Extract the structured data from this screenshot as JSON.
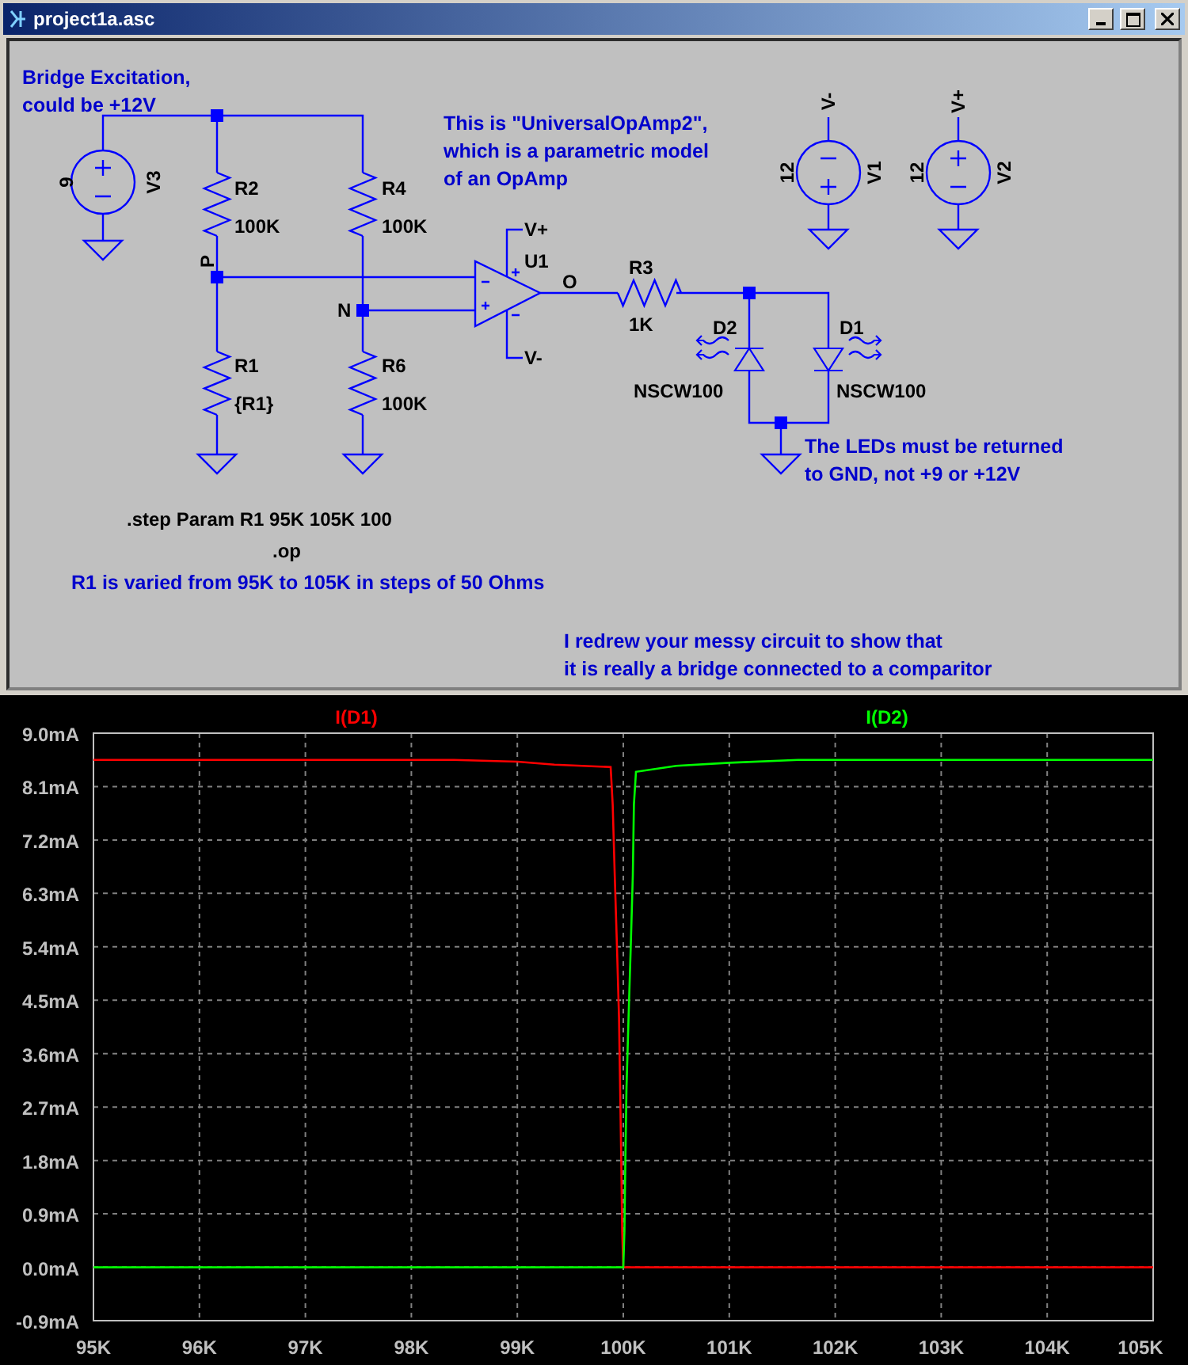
{
  "window": {
    "title": "project1a.asc"
  },
  "schematic": {
    "notes": [
      {
        "lines": [
          "Bridge Excitation,",
          "could be +12V"
        ]
      },
      {
        "lines": [
          "This is \"UniversalOpAmp2\",",
          "which is a parametric model",
          "of an OpAmp"
        ]
      },
      {
        "lines": [
          "The LEDs must be returned",
          "to GND, not +9 or +12V"
        ]
      },
      {
        "lines": [
          "R1 is varied from 95K to 105K in steps of 50 Ohms"
        ]
      },
      {
        "lines": [
          "I redrew your messy circuit to show that",
          "it is really a bridge connected to a comparitor"
        ]
      }
    ],
    "components": [
      {
        "kind": "voltage_source",
        "ref": "V3",
        "value": "9"
      },
      {
        "kind": "resistor",
        "ref": "R2",
        "value": "100K"
      },
      {
        "kind": "resistor",
        "ref": "R4",
        "value": "100K"
      },
      {
        "kind": "opamp",
        "ref": "U1"
      },
      {
        "kind": "resistor",
        "ref": "R3",
        "value": "1K"
      },
      {
        "kind": "voltage_source",
        "ref": "V1",
        "value": "12"
      },
      {
        "kind": "voltage_source",
        "ref": "V2",
        "value": "12"
      },
      {
        "kind": "led",
        "ref": "D2",
        "value": "NSCW100"
      },
      {
        "kind": "led",
        "ref": "D1",
        "value": "NSCW100"
      },
      {
        "kind": "resistor",
        "ref": "R1",
        "value": "{R1}"
      },
      {
        "kind": "resistor",
        "ref": "R6",
        "value": "100K"
      }
    ],
    "net_labels": [
      "P",
      "N",
      "O",
      "V+",
      "V-",
      "V-",
      "V+"
    ],
    "directives": [
      ".step Param R1 95K 105K 100",
      ".op"
    ]
  },
  "plot": {
    "chart_data": {
      "type": "line",
      "x": [
        95,
        98.4,
        99,
        99.35,
        99.88,
        99.9,
        99.92,
        99.94,
        99.96,
        99.97,
        99.98,
        99.99,
        100,
        100.01,
        100.02,
        100.03,
        100.05,
        100.07,
        100.09,
        100.1,
        100.12,
        100.5,
        101,
        101.65,
        105
      ],
      "series": [
        {
          "name": "I(D1)",
          "color": "#ff0000",
          "values": [
            8.55,
            8.55,
            8.52,
            8.47,
            8.43,
            7.8,
            6.6,
            5.4,
            4.2,
            3.0,
            1.8,
            0.6,
            0,
            0,
            0,
            0,
            0,
            0,
            0,
            0,
            0,
            0,
            0,
            0,
            0
          ]
        },
        {
          "name": "I(D2)",
          "color": "#00ff00",
          "values": [
            0,
            0,
            0,
            0,
            0,
            0,
            0,
            0,
            0,
            0,
            0,
            0,
            0,
            0.6,
            1.8,
            3.0,
            4.2,
            5.4,
            6.6,
            7.8,
            8.35,
            8.45,
            8.5,
            8.55,
            8.55
          ]
        }
      ],
      "grid": true,
      "xlim": [
        95,
        105
      ],
      "ylim": [
        -0.9,
        9.0
      ],
      "xticks": [
        {
          "value": 95,
          "label": "95K"
        },
        {
          "value": 96,
          "label": "96K"
        },
        {
          "value": 97,
          "label": "97K"
        },
        {
          "value": 98,
          "label": "98K"
        },
        {
          "value": 99,
          "label": "99K"
        },
        {
          "value": 100,
          "label": "100K"
        },
        {
          "value": 101,
          "label": "101K"
        },
        {
          "value": 102,
          "label": "102K"
        },
        {
          "value": 103,
          "label": "103K"
        },
        {
          "value": 104,
          "label": "104K"
        },
        {
          "value": 105,
          "label": "105K"
        }
      ],
      "yticks": [
        {
          "value": 9.0,
          "label": "9.0mA"
        },
        {
          "value": 8.1,
          "label": "8.1mA"
        },
        {
          "value": 7.2,
          "label": "7.2mA"
        },
        {
          "value": 6.3,
          "label": "6.3mA"
        },
        {
          "value": 5.4,
          "label": "5.4mA"
        },
        {
          "value": 4.5,
          "label": "4.5mA"
        },
        {
          "value": 3.6,
          "label": "3.6mA"
        },
        {
          "value": 2.7,
          "label": "2.7mA"
        },
        {
          "value": 1.8,
          "label": "1.8mA"
        },
        {
          "value": 0.9,
          "label": "0.9mA"
        },
        {
          "value": 0.0,
          "label": "0.0mA"
        },
        {
          "value": -0.9,
          "label": "-0.9mA"
        }
      ]
    }
  }
}
